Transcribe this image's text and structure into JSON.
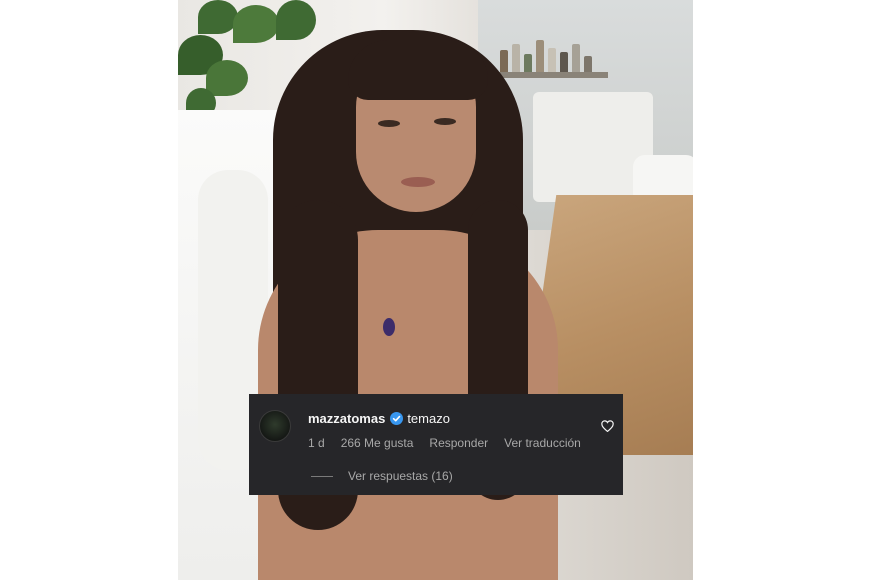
{
  "comment": {
    "username": "mazzatomas",
    "verified_icon": "verified-badge-icon",
    "text": "temazo",
    "time": "1 d",
    "likes": "266 Me gusta",
    "reply_label": "Responder",
    "translate_label": "Ver traducción",
    "view_replies_label": "Ver respuestas (16)",
    "like_icon": "heart-icon"
  },
  "colors": {
    "overlay_background": "#262629",
    "verified_blue": "#3897f0",
    "secondary_text": "#a8a8a8"
  }
}
